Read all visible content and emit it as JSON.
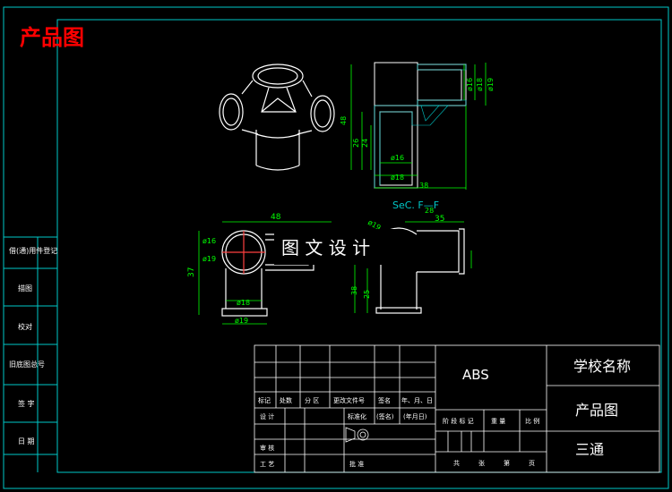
{
  "header": {
    "title": "产品图"
  },
  "center_label": "图 文 设 计",
  "section_label": "SeC. F—F",
  "dims": {
    "top_right_48": "48",
    "top_right_26": "26",
    "top_right_24": "24",
    "top_right_d16_a": "ø16",
    "top_right_d18_a": "ø18",
    "top_right_d19": "ø19",
    "top_right_d16_b": "ø16",
    "top_right_d18_b": "ø18",
    "top_right_38": "38",
    "bl_48": "48",
    "bl_37": "37",
    "bl_d16": "ø16",
    "bl_d19_a": "ø19",
    "bl_d18": "ø18",
    "bl_d19_b": "ø19",
    "br_35": "35",
    "br_38": "38",
    "br_25": "25",
    "br_28": "28",
    "br_19": "ø19"
  },
  "left_strip": [
    "借(通)用件登记",
    "描图",
    "校对",
    "旧底图总号",
    "签 字",
    "日 期"
  ],
  "title_block": {
    "material": "ABS",
    "school": "学校名称",
    "drawing_type": "产品图",
    "part_name": "三通",
    "row_headers": [
      "标记",
      "处数",
      "分 区",
      "更改文件号",
      "签名",
      "年、月、日"
    ],
    "design_row": [
      "设 计",
      "标准化",
      "(签名)",
      "(年月日)"
    ],
    "stage_headers": [
      "阶 段 标 记",
      "重 量",
      "比 例"
    ],
    "review": "审 核",
    "process": "工 艺",
    "approve": "批 准",
    "sheets": [
      "共",
      "张",
      "第",
      "页"
    ]
  },
  "colors": {
    "frame": "#00c8c8",
    "line": "#ffffff",
    "dim": "#00ff00",
    "title_red": "#ff0000",
    "hatch": "#00c8c8"
  }
}
